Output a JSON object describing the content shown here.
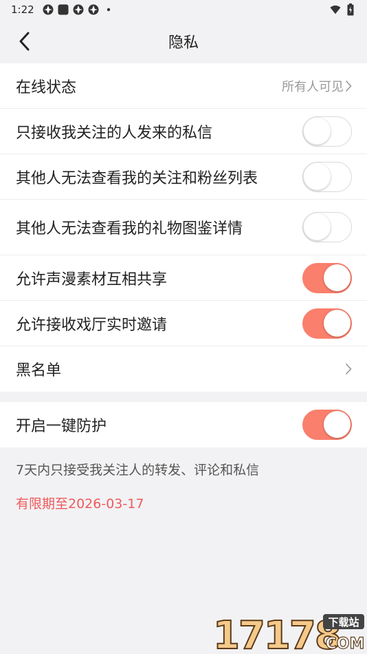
{
  "status_bar": {
    "time": "1:22",
    "icons": [
      "aperture-icon",
      "square-app-icon",
      "aperture-icon",
      "aperture-icon",
      "dot-icon"
    ],
    "right_icons": [
      "wifi-icon",
      "battery-icon"
    ]
  },
  "nav": {
    "title": "隐私",
    "back_icon": "chevron-left-icon"
  },
  "settings": {
    "online_status": {
      "label": "在线状态",
      "value": "所有人可见"
    },
    "only_followed_dm": {
      "label": "只接收我关注的人发来的私信",
      "on": false
    },
    "hide_follow_list": {
      "label": "其他人无法查看我的关注和粉丝列表",
      "on": false
    },
    "hide_gift_catalog": {
      "label": "其他人无法查看我的礼物图鉴详情",
      "on": false
    },
    "share_materials": {
      "label": "允许声漫素材互相共享",
      "on": true
    },
    "theater_invites": {
      "label": "允许接收戏厅实时邀请",
      "on": true
    },
    "blacklist": {
      "label": "黑名单"
    }
  },
  "protection": {
    "label": "开启一键防护",
    "on": true,
    "note": "7天内只接受我关注人的转发、评论和私信",
    "expiry": "有限期至2026-03-17"
  },
  "watermark": {
    "number": "17178",
    "badge": "下载站",
    "domain": "COM"
  },
  "colors": {
    "accent": "#fa7f6c",
    "expiry_text": "#f0595b",
    "background": "#f2f2f4"
  }
}
